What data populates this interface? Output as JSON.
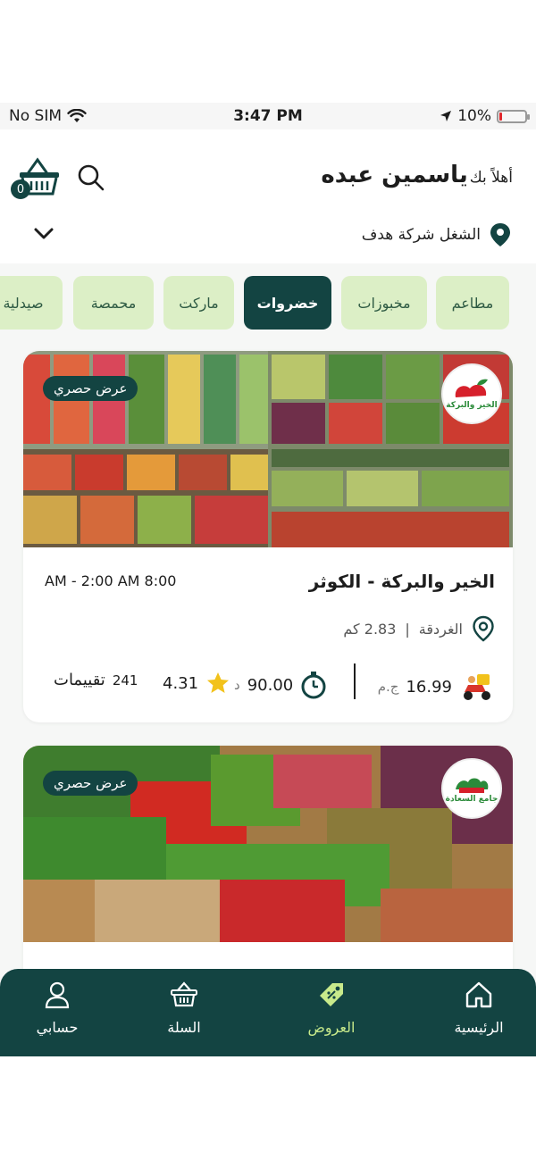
{
  "status": {
    "carrier": "No SIM",
    "time": "3:47 PM",
    "battery": "10%",
    "battery_level": 0.1
  },
  "header": {
    "greeting": "أهلاً بك",
    "user_name": "ياسمين عبده",
    "cart_count": "0",
    "location": "الشغل شركة هدف"
  },
  "categories": [
    {
      "label": "مطاعم"
    },
    {
      "label": "مخبوزات"
    },
    {
      "label": "خضروات"
    },
    {
      "label": "ماركت"
    },
    {
      "label": "محمصة"
    },
    {
      "label": "صيدلية"
    }
  ],
  "active_category": "خضروات",
  "stores": [
    {
      "badge": "عرض حصري",
      "logo_text": "الخير والبركة",
      "name": "الخير والبركة - الكوثر",
      "hours": "AM  - 2:00 AM 8:00",
      "city": "الغردقة",
      "distance": "2.83 كم",
      "delivery_fee": "16.99",
      "delivery_currency": "ج.م",
      "delivery_time": "90.00",
      "time_unit": "د",
      "rating": "4.31",
      "reviews_count": "241",
      "reviews_label": "تقييمات"
    },
    {
      "badge": "عرض حصري",
      "logo_text": "جامع السعادة"
    }
  ],
  "tabs": [
    {
      "label": "الرئيسية",
      "icon": "home-icon"
    },
    {
      "label": "العروض",
      "icon": "discount-tag-icon"
    },
    {
      "label": "السلة",
      "icon": "basket-icon"
    },
    {
      "label": "حسابي",
      "icon": "user-icon"
    }
  ],
  "colors": {
    "primary": "#134442",
    "chip": "#dcefc6",
    "active_tab": "#c8ea8b",
    "star": "#f2c21b"
  }
}
